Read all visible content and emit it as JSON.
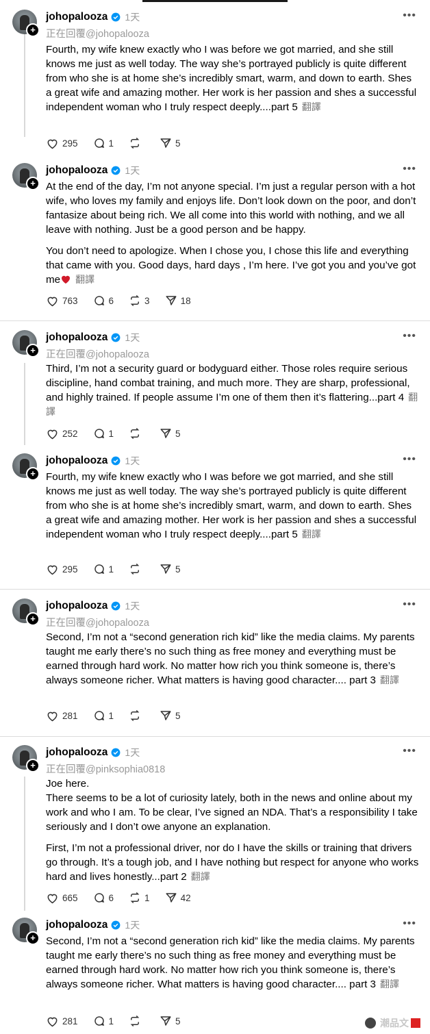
{
  "posts": [
    {
      "user": "johopalooza",
      "time": "1天",
      "reply": "正在回覆@johopalooza",
      "paragraphs": [
        "Fourth, my wife knew exactly who I was before we got married, and she still knows me just as well today. The way she’s portrayed publicly is quite different from who she is at home she’s incredibly smart, warm, and down to earth. Shes a great wife and amazing mother. Her work is her passion and shes a successful independent woman who I truly respect deeply....part 5"
      ],
      "translate": "翻譯",
      "likes": "295",
      "comments": "1",
      "reposts": "",
      "shares": "5"
    },
    {
      "user": "johopalooza",
      "time": "1天",
      "reply": "",
      "paragraphs": [
        "At the end of the day, I’m not anyone special. I’m just a regular person with a hot wife, who loves my family and enjoys life. Don’t look down on the poor, and don’t fantasize about being rich. We all come into this world with nothing, and we all leave with nothing. Just be a good person and be happy.",
        "You don’t need to apologize. When I chose you, I chose this life and everything that came with you. Good days, hard days , I’m here. I’ve got you and you’ve got me"
      ],
      "translate": "翻譯",
      "likes": "763",
      "comments": "6",
      "reposts": "3",
      "shares": "18"
    },
    {
      "user": "johopalooza",
      "time": "1天",
      "reply": "正在回覆@johopalooza",
      "paragraphs": [
        "Third, I’m not a security guard or bodyguard either. Those roles require serious discipline, hand combat training, and much more. They are sharp, professional, and highly trained. If people assume I’m one of them then it’s flattering...part 4"
      ],
      "translate": "翻譯",
      "likes": "252",
      "comments": "1",
      "reposts": "",
      "shares": "5"
    },
    {
      "user": "johopalooza",
      "time": "1天",
      "reply": "",
      "paragraphs": [
        "Fourth, my wife knew exactly who I was before we got married, and she still knows me just as well today. The way she’s portrayed publicly is quite different from who she is at home she’s incredibly smart, warm, and down to earth. Shes a great wife and amazing mother. Her work is her passion and shes a successful independent woman who I truly respect deeply....part 5"
      ],
      "translate": "翻譯",
      "likes": "295",
      "comments": "1",
      "reposts": "",
      "shares": "5"
    },
    {
      "user": "johopalooza",
      "time": "1天",
      "reply": "正在回覆@johopalooza",
      "paragraphs": [
        "Second, I’m not a “second generation rich kid” like the media claims. My parents taught me early there’s no such thing as free money and everything must be earned through hard work. No matter how rich you think someone is, there’s always someone richer. What matters is having good character.... part 3"
      ],
      "translate": "翻譯",
      "likes": "281",
      "comments": "1",
      "reposts": "",
      "shares": "5"
    },
    {
      "user": "johopalooza",
      "time": "1天",
      "reply": "正在回覆@pinksophia0818",
      "paragraphs": [
        "Joe here.\nThere seems to be a lot of curiosity lately, both in the news and online about my work and who I am. To be clear, I’ve signed an NDA. That’s a responsibility I take seriously and I don’t owe anyone an explanation.",
        "First, I’m not a professional driver, nor do I have the skills or training that drivers go through. It’s a tough job, and I have nothing but respect for anyone who works hard and lives honestly...part 2"
      ],
      "translate": "翻譯",
      "likes": "665",
      "comments": "6",
      "reposts": "1",
      "shares": "42"
    },
    {
      "user": "johopalooza",
      "time": "1天",
      "reply": "",
      "paragraphs": [
        "Second, I’m not a “second generation rich kid” like the media claims. My parents taught me early there’s no such thing as free money and everything must be earned through hard work. No matter how rich you think someone is, there’s always someone richer. What matters is having good character.... part 3"
      ],
      "translate": "翻譯",
      "likes": "281",
      "comments": "1",
      "reposts": "",
      "shares": "5"
    }
  ],
  "watermark": "潮品文",
  "colors": {
    "verified": "#0095f6",
    "heart": "#e0245e"
  }
}
